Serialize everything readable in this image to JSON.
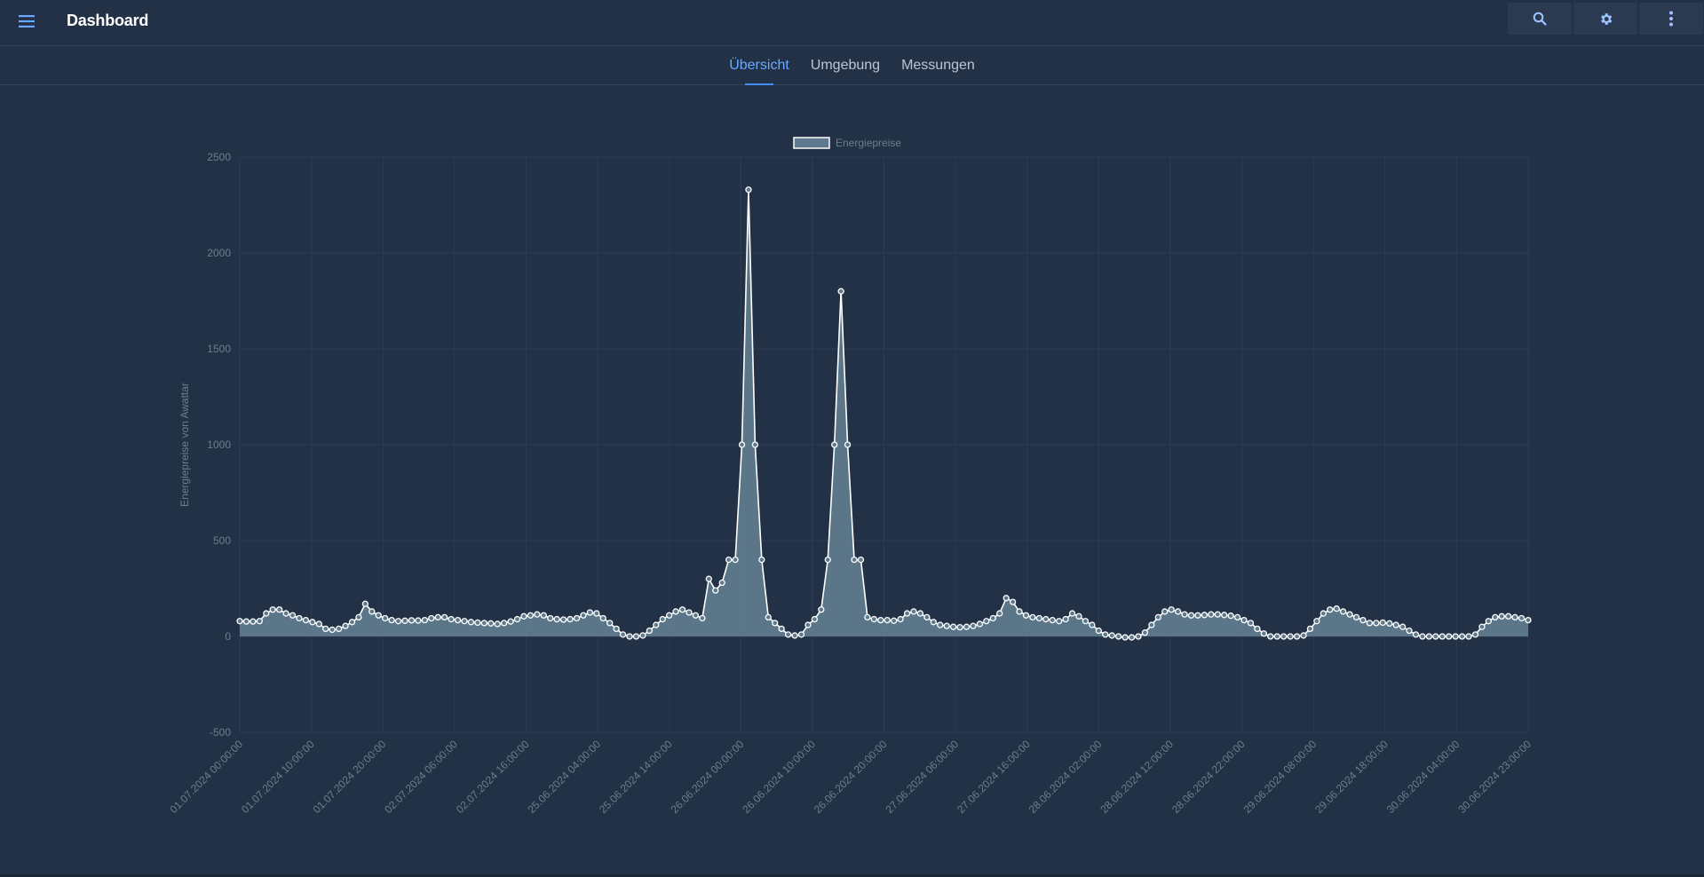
{
  "header": {
    "title": "Dashboard",
    "menu_icon": "menu-icon",
    "actions": [
      {
        "name": "search-button",
        "icon": "search-icon"
      },
      {
        "name": "settings-button",
        "icon": "gear-icon"
      },
      {
        "name": "more-button",
        "icon": "more-vertical-icon"
      }
    ]
  },
  "tabs": [
    {
      "label": "Übersicht",
      "active": true
    },
    {
      "label": "Umgebung",
      "active": false
    },
    {
      "label": "Messungen",
      "active": false
    }
  ],
  "colors": {
    "background": "#233147",
    "accent": "#4a8df6",
    "area_fill": "#5f7a8c",
    "line": "#ffffff"
  },
  "chart_data": {
    "type": "area",
    "legend": [
      "Energiepreise"
    ],
    "legend_position": "top-center",
    "ylabel": "Energiepreise von Awattar",
    "xlabel": "",
    "ylim": [
      -500,
      2500
    ],
    "yticks": [
      -500,
      0,
      500,
      1000,
      1500,
      2000,
      2500
    ],
    "grid": true,
    "x_tick_labels": [
      "01.07.2024 00:00:00",
      "01.07.2024 10:00:00",
      "01.07.2024 20:00:00",
      "02.07.2024 06:00:00",
      "02.07.2024 16:00:00",
      "25.06.2024 04:00:00",
      "25.06.2024 14:00:00",
      "26.06.2024 00:00:00",
      "26.06.2024 10:00:00",
      "26.06.2024 20:00:00",
      "27.06.2024 06:00:00",
      "27.06.2024 16:00:00",
      "28.06.2024 02:00:00",
      "28.06.2024 12:00:00",
      "28.06.2024 22:00:00",
      "29.06.2024 08:00:00",
      "29.06.2024 18:00:00",
      "30.06.2024 04:00:00",
      "30.06.2024 23:00:00"
    ],
    "series": [
      {
        "name": "Energiepreise",
        "values": [
          80,
          78,
          78,
          80,
          120,
          140,
          140,
          120,
          110,
          95,
          85,
          75,
          65,
          40,
          35,
          40,
          55,
          75,
          100,
          170,
          130,
          110,
          95,
          85,
          80,
          82,
          84,
          83,
          85,
          95,
          100,
          100,
          90,
          85,
          80,
          75,
          72,
          70,
          68,
          65,
          70,
          78,
          90,
          105,
          110,
          115,
          110,
          95,
          90,
          88,
          90,
          95,
          110,
          125,
          120,
          95,
          70,
          40,
          10,
          0,
          0,
          5,
          30,
          60,
          90,
          110,
          130,
          140,
          125,
          110,
          95,
          300,
          240,
          280,
          400,
          400,
          1000,
          2330,
          1000,
          400,
          100,
          70,
          40,
          10,
          5,
          10,
          60,
          90,
          140,
          400,
          1000,
          1800,
          1000,
          400,
          400,
          100,
          90,
          85,
          85,
          82,
          90,
          120,
          130,
          120,
          100,
          75,
          60,
          55,
          50,
          48,
          50,
          55,
          65,
          80,
          95,
          120,
          200,
          180,
          130,
          110,
          100,
          95,
          90,
          85,
          80,
          90,
          120,
          105,
          80,
          60,
          30,
          10,
          5,
          0,
          -5,
          -5,
          0,
          20,
          60,
          100,
          130,
          140,
          130,
          115,
          110,
          110,
          112,
          115,
          115,
          112,
          108,
          100,
          85,
          70,
          40,
          15,
          0,
          0,
          0,
          0,
          0,
          5,
          40,
          80,
          120,
          140,
          145,
          130,
          115,
          100,
          85,
          70,
          70,
          72,
          68,
          60,
          50,
          30,
          10,
          0,
          0,
          0,
          0,
          0,
          0,
          0,
          0,
          10,
          50,
          80,
          100,
          105,
          105,
          100,
          95,
          85
        ]
      }
    ]
  }
}
